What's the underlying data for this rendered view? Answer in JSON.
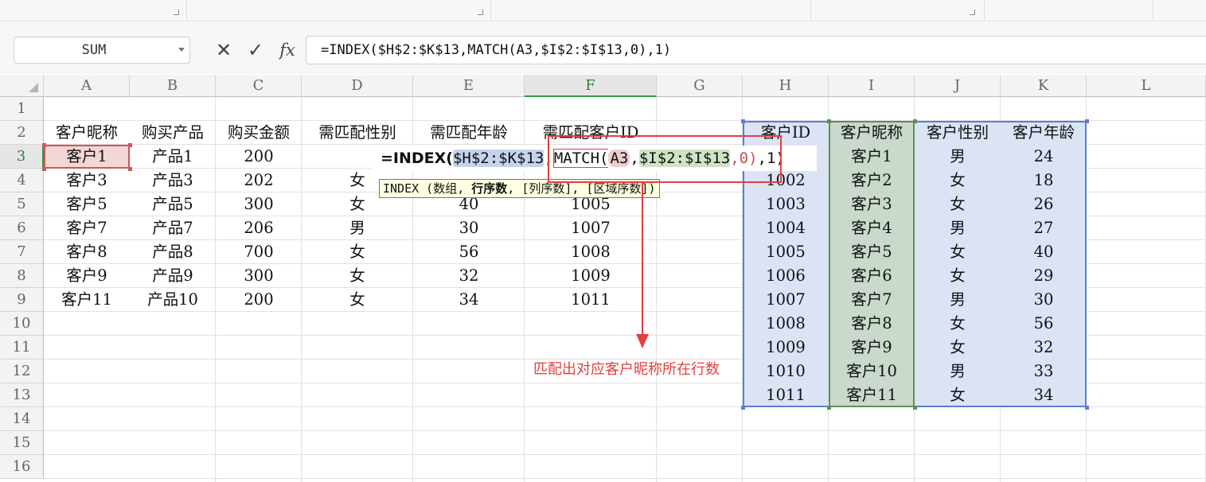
{
  "namebox": {
    "value": "SUM",
    "dropdown_icon": "caret-down-icon"
  },
  "formula_bar": {
    "cancel_icon": "cross-icon",
    "confirm_icon": "check-icon",
    "fx_label": "fx",
    "formula": "=INDEX($H$2:$K$13,MATCH(A3,$I$2:$I$13,0),1)"
  },
  "columns": [
    "A",
    "B",
    "C",
    "D",
    "E",
    "F",
    "G",
    "H",
    "I",
    "J",
    "K",
    "L"
  ],
  "active_column": "F",
  "rows": [
    "1",
    "2",
    "3",
    "4",
    "5",
    "6",
    "7",
    "8",
    "9",
    "10",
    "11",
    "12",
    "13",
    "14",
    "15",
    "16"
  ],
  "active_row": "3",
  "left_table": {
    "headers": [
      "客户昵称",
      "购买产品",
      "购买金额",
      "需匹配性别",
      "需匹配年龄",
      "需匹配客户ID"
    ],
    "rows": [
      [
        "客户1",
        "产品1",
        "200",
        "",
        "",
        ""
      ],
      [
        "客户3",
        "产品3",
        "202",
        "女",
        "",
        ""
      ],
      [
        "客户5",
        "产品5",
        "300",
        "女",
        "40",
        "1005"
      ],
      [
        "客户7",
        "产品7",
        "206",
        "男",
        "30",
        "1007"
      ],
      [
        "客户8",
        "产品8",
        "700",
        "女",
        "56",
        "1008"
      ],
      [
        "客户9",
        "产品9",
        "300",
        "女",
        "32",
        "1009"
      ],
      [
        "客户11",
        "产品10",
        "200",
        "女",
        "34",
        "1011"
      ]
    ]
  },
  "cell_edit": {
    "prefix": "=INDEX(",
    "range1": "$H$2:$K$13",
    "comma1": ",",
    "match_fn": "MATCH(",
    "ref_a3": "A3",
    "comma2": ",",
    "range2": "$I$2:$I$13",
    "rest_inner": ",0)",
    "rest_outer": ",1)"
  },
  "tooltip": {
    "func": "INDEX",
    "paren_open": " (数组, ",
    "bold_arg": "行序数",
    "rest": ", [列序数], [区域序数])"
  },
  "right_table": {
    "headers": [
      "客户ID",
      "客户昵称",
      "客户性别",
      "客户年龄"
    ],
    "rows": [
      [
        "",
        "客户1",
        "男",
        "24"
      ],
      [
        "1002",
        "客户2",
        "女",
        "18"
      ],
      [
        "1003",
        "客户3",
        "女",
        "26"
      ],
      [
        "1004",
        "客户4",
        "男",
        "27"
      ],
      [
        "1005",
        "客户5",
        "女",
        "40"
      ],
      [
        "1006",
        "客户6",
        "女",
        "29"
      ],
      [
        "1007",
        "客户7",
        "男",
        "30"
      ],
      [
        "1008",
        "客户8",
        "女",
        "56"
      ],
      [
        "1009",
        "客户9",
        "女",
        "32"
      ],
      [
        "1010",
        "客户10",
        "男",
        "33"
      ],
      [
        "1011",
        "客户11",
        "女",
        "34"
      ]
    ]
  },
  "annotation": {
    "text": "匹配出对应客户昵称所在行数"
  },
  "colors": {
    "range_blue": "#dbe3f5",
    "range_blue_border": "#5b7fd1",
    "range_green": "#c9d9cb",
    "range_green_border": "#5f8f52",
    "ref_red": "#f4d6d6",
    "ref_red_border": "#c85a5a",
    "annotation_red": "#e53e3e",
    "active_green": "#2f9a46"
  }
}
